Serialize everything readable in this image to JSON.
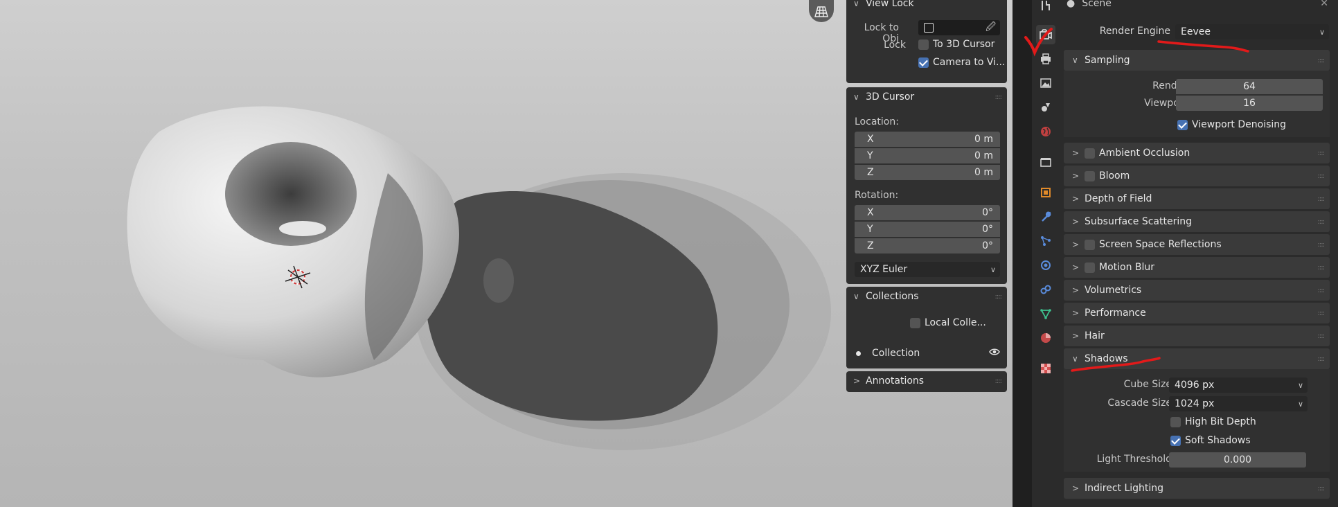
{
  "viewport": {
    "navigation_icon": "grid-view-icon"
  },
  "npanel": {
    "view_lock": {
      "title": "View Lock",
      "lock_to_obj_label": "Lock to Obj",
      "lock_label": "Lock",
      "to_3d_cursor": {
        "label": "To 3D Cursor",
        "checked": false
      },
      "camera_to_view": {
        "label": "Camera to Vi...",
        "checked": true
      }
    },
    "cursor": {
      "title": "3D Cursor",
      "location_label": "Location:",
      "location": [
        {
          "axis": "X",
          "value": "0 m"
        },
        {
          "axis": "Y",
          "value": "0 m"
        },
        {
          "axis": "Z",
          "value": "0 m"
        }
      ],
      "rotation_label": "Rotation:",
      "rotation": [
        {
          "axis": "X",
          "value": "0°"
        },
        {
          "axis": "Y",
          "value": "0°"
        },
        {
          "axis": "Z",
          "value": "0°"
        }
      ],
      "rotation_mode": "XYZ Euler"
    },
    "collections": {
      "title": "Collections",
      "local_collections": {
        "label": "Local Colle...",
        "checked": false
      },
      "item": "Collection"
    },
    "annotations": {
      "title": "Annotations"
    }
  },
  "properties": {
    "header_title": "Scene",
    "render_engine_label": "Render Engine",
    "render_engine_value": "Eevee",
    "sampling": {
      "title": "Sampling",
      "render_label": "Render",
      "render_value": "64",
      "viewport_label": "Viewport",
      "viewport_value": "16",
      "viewport_denoising": {
        "label": "Viewport Denoising",
        "checked": true
      }
    },
    "panels": [
      {
        "title": "Ambient Occlusion",
        "has_checkbox": true
      },
      {
        "title": "Bloom",
        "has_checkbox": true
      },
      {
        "title": "Depth of Field",
        "has_checkbox": false
      },
      {
        "title": "Subsurface Scattering",
        "has_checkbox": false
      },
      {
        "title": "Screen Space Reflections",
        "has_checkbox": true
      },
      {
        "title": "Motion Blur",
        "has_checkbox": true
      },
      {
        "title": "Volumetrics",
        "has_checkbox": false
      },
      {
        "title": "Performance",
        "has_checkbox": false
      },
      {
        "title": "Hair",
        "has_checkbox": false
      }
    ],
    "shadows": {
      "title": "Shadows",
      "cube_size_label": "Cube Size",
      "cube_size_value": "4096 px",
      "cascade_size_label": "Cascade Size",
      "cascade_size_value": "1024 px",
      "high_bit_depth": {
        "label": "High Bit Depth",
        "checked": false
      },
      "soft_shadows": {
        "label": "Soft Shadows",
        "checked": true
      },
      "light_threshold_label": "Light Threshold",
      "light_threshold_value": "0.000"
    },
    "indirect_lighting": {
      "title": "Indirect Lighting"
    }
  },
  "colors": {
    "accent": "#4772b3",
    "annotation_red": "#e21a1a"
  }
}
